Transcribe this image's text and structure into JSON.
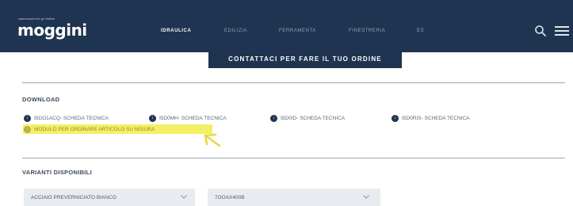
{
  "header": {
    "logo_tagline": "mamoeaaiol ent ge ffaffom",
    "logo": "moggini",
    "nav": [
      {
        "label": "IDRAULICA",
        "active": true
      },
      {
        "label": "EDILIZIA",
        "active": false
      },
      {
        "label": "FERRAMENTA",
        "active": false
      },
      {
        "label": "FINESTRERIA",
        "active": false
      },
      {
        "label": "ES",
        "active": false
      }
    ],
    "icons": [
      "search-icon",
      "menu-icon"
    ]
  },
  "cta": {
    "label": "CONTATTACI PER FARE IL TUO ORDINE"
  },
  "download": {
    "title": "DOWNLOAD",
    "links": [
      {
        "label": "I5DO1ACQ- SCHEDA TECNICA"
      },
      {
        "label": "I5D0MH- SCHEDA TECNICA"
      },
      {
        "label": "I5D0ID- SCHEDA TECNICA"
      },
      {
        "label": "I5D0RIS- SCHEDA TECNICA"
      }
    ],
    "highlighted_link": {
      "label": "MODULO PER ORDINARE ARTICOLO SU MISURA"
    }
  },
  "variants": {
    "title": "VARIANTI DISPONIBILI",
    "selects": [
      {
        "value": "ACCIAIO PREVERNICIATO BIANCO"
      },
      {
        "value": "7OOAX400B"
      }
    ]
  },
  "colors": {
    "navy": "#1f3450",
    "highlight": "#f4f063",
    "cursor": "#e7d84a"
  }
}
